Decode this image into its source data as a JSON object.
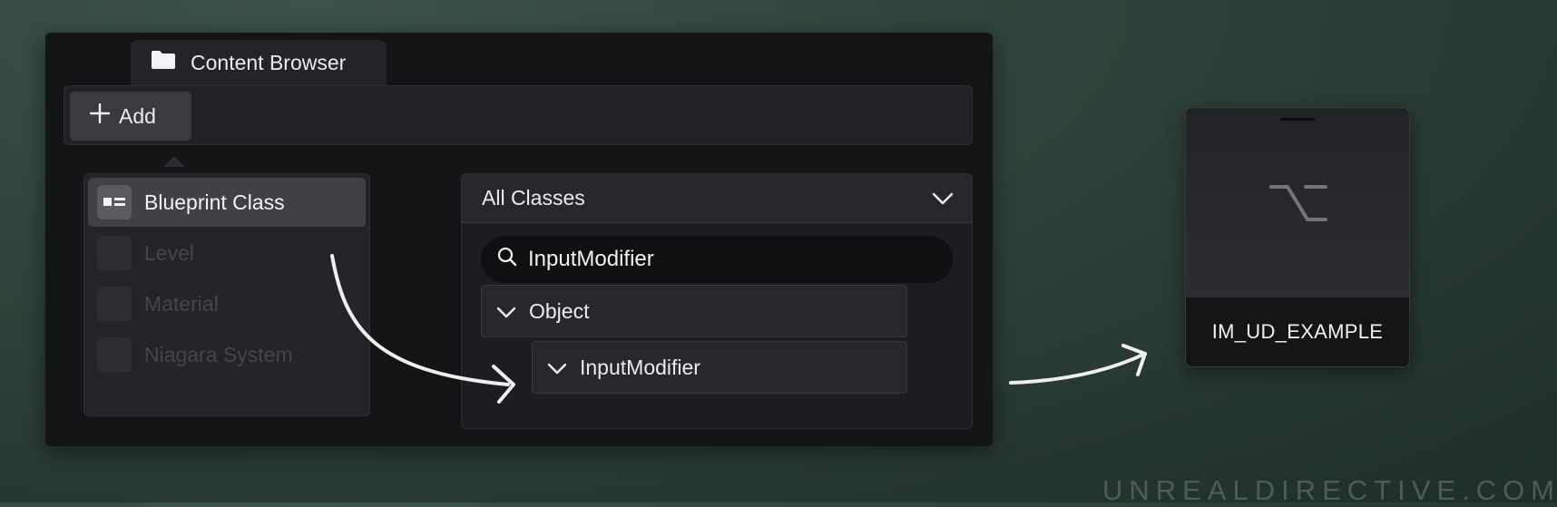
{
  "window": {
    "tab_title": "Content Browser",
    "tab_icon": "folder-icon"
  },
  "toolbar": {
    "add_label": "Add",
    "add_icon": "plus-icon"
  },
  "add_menu": {
    "items": [
      {
        "label": "Blueprint Class",
        "icon": "blueprint-class-icon",
        "state": "highlighted"
      },
      {
        "label": "Level",
        "icon": "level-icon",
        "state": "faded"
      },
      {
        "label": "Material",
        "icon": "material-icon",
        "state": "faded"
      },
      {
        "label": "Niagara System",
        "icon": "niagara-system-icon",
        "state": "faded"
      }
    ]
  },
  "class_picker": {
    "header": "All Classes",
    "search_value": "InputModifier",
    "tree": [
      {
        "label": "Object",
        "expanded": true,
        "level": 0
      },
      {
        "label": "InputModifier",
        "expanded": true,
        "level": 1
      }
    ]
  },
  "asset": {
    "name": "IM_UD_EXAMPLE",
    "icon": "option-key-icon"
  },
  "watermark": "UNREALDIRECTIVE.COM",
  "colors": {
    "background": "#2e4239",
    "panel": "#131416",
    "arrow": "#eeeeee"
  }
}
